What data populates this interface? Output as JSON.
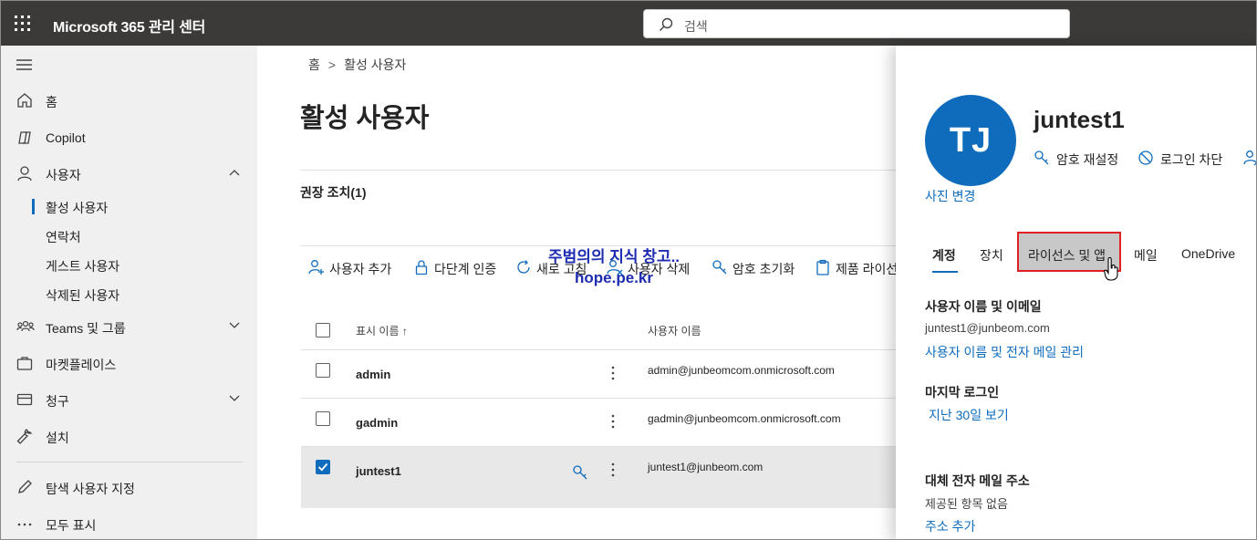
{
  "app": {
    "title": "Microsoft 365 관리 센터"
  },
  "search": {
    "placeholder": "검색"
  },
  "sidebar": {
    "items": [
      {
        "label": "홈",
        "icon": "home-icon"
      },
      {
        "label": "Copilot",
        "icon": "copilot-icon"
      },
      {
        "label": "사용자",
        "icon": "person-icon",
        "expanded": true
      },
      {
        "label": "Teams 및 그룹",
        "icon": "teams-icon",
        "expanded": false
      },
      {
        "label": "마켓플레이스",
        "icon": "briefcase-icon"
      },
      {
        "label": "청구",
        "icon": "billing-icon",
        "expanded": false
      },
      {
        "label": "설치",
        "icon": "wrench-icon"
      },
      {
        "label": "탐색 사용자 지정",
        "icon": "pencil-icon"
      },
      {
        "label": "모두 표시",
        "icon": "more-icon"
      }
    ],
    "subitems": [
      {
        "label": "활성 사용자",
        "active": true
      },
      {
        "label": "연락처"
      },
      {
        "label": "게스트 사용자"
      },
      {
        "label": "삭제된 사용자"
      }
    ]
  },
  "breadcrumb": {
    "home": "홈",
    "current": "활성 사용자"
  },
  "page": {
    "title": "활성 사용자",
    "recommended": "권장 조치(1)"
  },
  "commands": [
    {
      "label": "사용자 추가",
      "icon": "add-person-icon"
    },
    {
      "label": "다단계 인증",
      "icon": "lock-icon"
    },
    {
      "label": "새로 고침",
      "icon": "refresh-icon"
    },
    {
      "label": "사용자 삭제",
      "icon": "delete-person-icon"
    },
    {
      "label": "암호 초기화",
      "icon": "key-icon"
    },
    {
      "label": "제품 라이선스",
      "icon": "clipboard-icon"
    }
  ],
  "table": {
    "headers": {
      "display_name": "표시 이름 ↑",
      "username": "사용자 이름"
    },
    "rows": [
      {
        "name": "admin",
        "email": "admin@junbeomcom.onmicrosoft.com",
        "selected": false
      },
      {
        "name": "gadmin",
        "email": "gadmin@junbeomcom.onmicrosoft.com",
        "selected": false
      },
      {
        "name": "juntest1",
        "email": "juntest1@junbeom.com",
        "selected": true
      }
    ]
  },
  "watermark": {
    "line1": "주범의의 지식 창고..",
    "line2": "hope.pe.kr"
  },
  "panel": {
    "initials": "TJ",
    "photo_change": "사진 변경",
    "user_name": "juntest1",
    "actions": [
      {
        "label": "암호 재설정",
        "icon": "key-icon"
      },
      {
        "label": "로그인 차단",
        "icon": "block-icon"
      }
    ],
    "tabs": [
      {
        "label": "계정",
        "active": true
      },
      {
        "label": "장치"
      },
      {
        "label": "라이선스 및 앱",
        "highlighted": true
      },
      {
        "label": "메일"
      },
      {
        "label": "OneDrive"
      }
    ],
    "sections": {
      "username_email": {
        "title": "사용자 이름 및 이메일",
        "value": "juntest1@junbeom.com",
        "link": "사용자 이름 및 전자 메일 관리"
      },
      "last_login": {
        "title": "마지막 로그인",
        "link": "지난 30일 보기"
      },
      "alt_email": {
        "title": "대체 전자 메일 주소",
        "value": "제공된 항목 없음",
        "link": "주소 추가"
      }
    }
  },
  "colors": {
    "topbar": "#3b3a39",
    "sidebar": "#f0f0f0",
    "accent": "#0f6cbd",
    "highlight_border": "#e02020"
  }
}
